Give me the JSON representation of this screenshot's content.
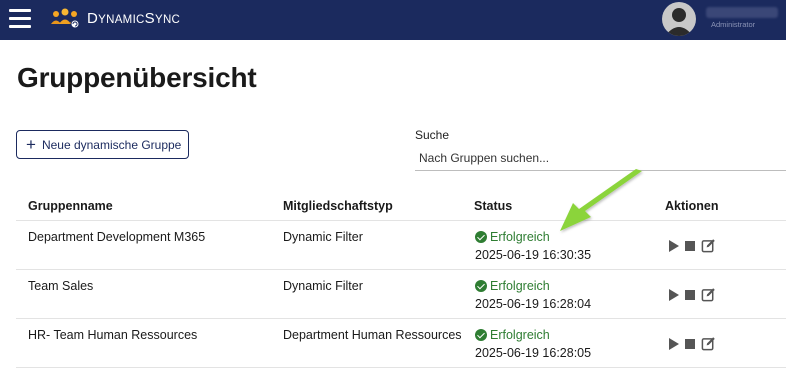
{
  "header": {
    "brand_big": "D",
    "brand_rest": "YNAMIC",
    "brand_big2": "S",
    "brand_rest2": "YNC",
    "role": "Administrator"
  },
  "page": {
    "title": "Gruppenübersicht"
  },
  "toolbar": {
    "new_group_label": "Neue dynamische Gruppe",
    "search_label": "Suche",
    "search_placeholder": "Nach Gruppen suchen..."
  },
  "table": {
    "headers": [
      "Gruppenname",
      "Mitgliedschaftstyp",
      "Status",
      "Aktionen"
    ],
    "rows": [
      {
        "name": "Department Development M365",
        "type": "Dynamic Filter",
        "status": "Erfolgreich",
        "time": "2025-06-19 16:30:35"
      },
      {
        "name": "Team Sales",
        "type": "Dynamic Filter",
        "status": "Erfolgreich",
        "time": "2025-06-19 16:28:04"
      },
      {
        "name": "HR- Team Human Ressources",
        "type": "Department Human Ressources",
        "status": "Erfolgreich",
        "time": "2025-06-19 16:28:05"
      }
    ]
  },
  "icons": {
    "menu": "hamburger-menu-icon",
    "logo": "people-group-icon",
    "avatar": "user-avatar-icon",
    "status": "check-circle-icon",
    "play": "play-icon",
    "stop": "stop-icon",
    "edit": "edit-icon"
  },
  "colors": {
    "header_bg": "#1b2a5e",
    "success": "#2e7d32",
    "annotation_arrow": "#8bd43a"
  }
}
